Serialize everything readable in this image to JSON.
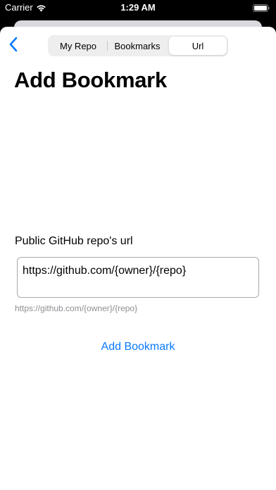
{
  "status_bar": {
    "carrier": "Carrier",
    "time": "1:29 AM",
    "icons": [
      "wifi-icon",
      "battery-icon"
    ]
  },
  "nav": {
    "back_icon": "chevron-left-icon",
    "segments": [
      {
        "label": "My Repo",
        "selected": false
      },
      {
        "label": "Bookmarks",
        "selected": false
      },
      {
        "label": "Url",
        "selected": true
      }
    ]
  },
  "page": {
    "title": "Add Bookmark",
    "field_label": "Public GitHub repo's url",
    "input_value": "https://github.com/{owner}/{repo}",
    "hint": "https://github.com/{owner}/{repo}",
    "submit_label": "Add Bookmark"
  },
  "colors": {
    "accent": "#0a7aff",
    "hint": "#8e8e93",
    "background": "#ffffff",
    "segment_background": "#eeeeef"
  }
}
